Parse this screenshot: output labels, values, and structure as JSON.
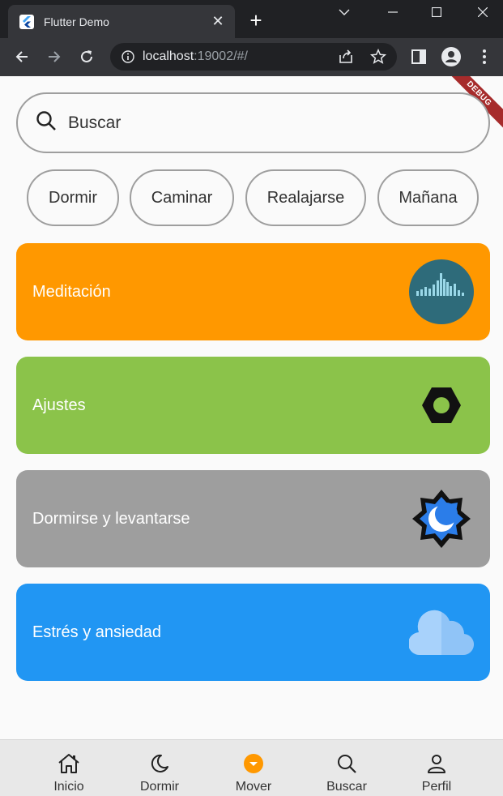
{
  "browser": {
    "tab_title": "Flutter Demo",
    "url_host": "localhost",
    "url_rest": ":19002/#/"
  },
  "debug_banner": "DEBUG",
  "search": {
    "placeholder": "Buscar"
  },
  "chips": [
    "Dormir",
    "Caminar",
    "Realajarse",
    "Mañana"
  ],
  "cards": [
    {
      "label": "Meditación",
      "color": "#ff9800",
      "icon": "meditation-wave-icon"
    },
    {
      "label": "Ajustes",
      "color": "#8bc34a",
      "icon": "hex-nut-icon"
    },
    {
      "label": "Dormirse y levantarse",
      "color": "#9e9e9e",
      "icon": "moon-badge-icon"
    },
    {
      "label": "Estrés y ansiedad",
      "color": "#2196f3",
      "icon": "cloud-icon"
    }
  ],
  "bottom_nav": [
    {
      "label": "Inicio",
      "icon": "home-icon"
    },
    {
      "label": "Dormir",
      "icon": "moon-icon"
    },
    {
      "label": "Mover",
      "icon": "move-dot-icon"
    },
    {
      "label": "Buscar",
      "icon": "search-icon"
    },
    {
      "label": "Perfil",
      "icon": "person-icon"
    }
  ],
  "colors": {
    "accent": "#ff9800"
  }
}
